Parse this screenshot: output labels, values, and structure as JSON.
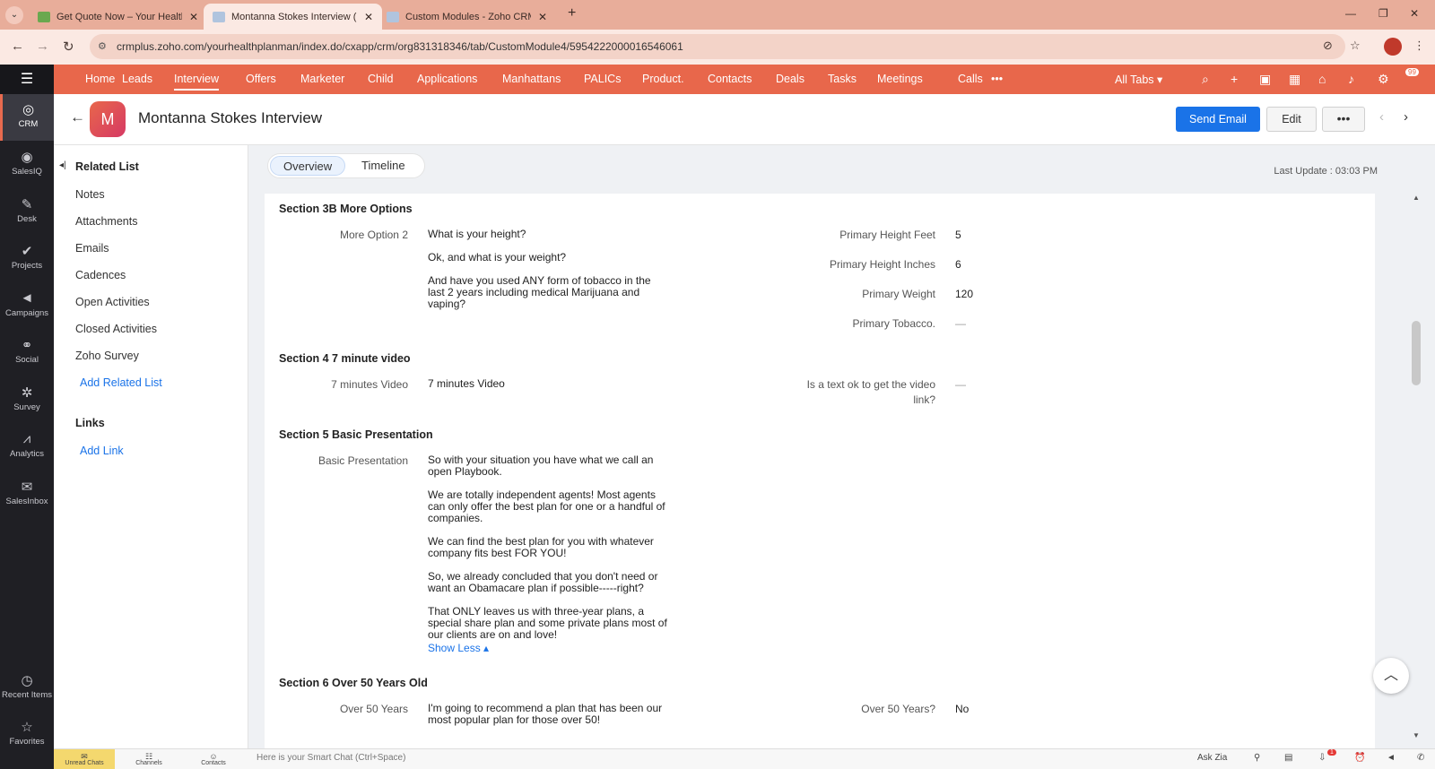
{
  "browser": {
    "tabs": [
      {
        "title": "Get Quote Now – Your Health P",
        "active": false
      },
      {
        "title": "Montanna Stokes Interview (Int",
        "active": true
      },
      {
        "title": "Custom Modules - Zoho CRM",
        "active": false
      }
    ],
    "url": "crmplus.zoho.com/yourhealthplanman/index.do/cxapp/crm/org831318346/tab/CustomModule4/5954222000016546061"
  },
  "rail": {
    "items": [
      {
        "label": "CRM",
        "icon": "crm-icon"
      },
      {
        "label": "SalesIQ",
        "icon": "salesiq-icon"
      },
      {
        "label": "Desk",
        "icon": "desk-icon"
      },
      {
        "label": "Projects",
        "icon": "projects-icon"
      },
      {
        "label": "Campaigns",
        "icon": "campaigns-icon"
      },
      {
        "label": "Social",
        "icon": "social-icon"
      },
      {
        "label": "Survey",
        "icon": "survey-icon"
      },
      {
        "label": "Analytics",
        "icon": "analytics-icon"
      },
      {
        "label": "SalesInbox",
        "icon": "salesinbox-icon"
      }
    ],
    "bottom": [
      {
        "label": "Recent Items",
        "icon": "clock-icon"
      },
      {
        "label": "Favorites",
        "icon": "star-icon"
      }
    ]
  },
  "nav": {
    "items": [
      "Home",
      "Leads",
      "Interview",
      "Offers",
      "Marketer",
      "Child",
      "Applications",
      "Manhattans",
      "PALICs",
      "Product.",
      "Contacts",
      "Deals",
      "Tasks",
      "Meetings",
      "Calls"
    ],
    "active": "Interview",
    "more": "•••",
    "all_tabs": "All Tabs ▾",
    "notification_count": "99"
  },
  "record": {
    "avatar_letter": "M",
    "title": "Montanna Stokes Interview",
    "send_email": "Send Email",
    "edit": "Edit",
    "more": "•••"
  },
  "related": {
    "heading": "Related List",
    "items": [
      "Notes",
      "Attachments",
      "Emails",
      "Cadences",
      "Open Activities",
      "Closed Activities",
      "Zoho Survey"
    ],
    "add_related": "Add Related List",
    "links_heading": "Links",
    "add_link": "Add Link"
  },
  "view": {
    "tabs": [
      "Overview",
      "Timeline"
    ],
    "last_update": "Last Update : 03:03 PM"
  },
  "sections": {
    "s3b": {
      "title": "Section 3B More Options",
      "label": "More Option 2",
      "lines": [
        "What is your height?",
        "Ok, and what is your weight?",
        "And have you used ANY form of tobacco in the",
        "last 2 years including medical Marijuana and",
        "vaping?"
      ],
      "fields": [
        {
          "label": "Primary Height Feet",
          "value": "5"
        },
        {
          "label": "Primary Height Inches",
          "value": "6"
        },
        {
          "label": "Primary Weight",
          "value": "120"
        },
        {
          "label": "Primary Tobacco.",
          "value": "—"
        }
      ]
    },
    "s4": {
      "title": "Section 4 7 minute video",
      "label": "7 minutes Video",
      "value": "7 minutes Video",
      "field_label_1": "Is a text ok to get the video",
      "field_label_2": "link?",
      "field_value": "—"
    },
    "s5": {
      "title": "Section 5 Basic Presentation",
      "label": "Basic Presentation",
      "lines": [
        "So with your situation you have what we call an",
        "open Playbook.",
        "We are totally independent agents! Most agents",
        "can only offer the best plan for one or a handful of",
        "companies.",
        "We can find the best plan for you with whatever",
        "company fits best FOR YOU!",
        "So, we already concluded that you don't need or",
        "want an Obamacare plan if possible-----right?",
        "That ONLY leaves us with three-year plans, a",
        "special share plan and some private plans most of",
        "our clients are on and love!"
      ],
      "show_less": "Show Less ▴"
    },
    "s6": {
      "title": "Section 6 Over 50 Years Old",
      "label": "Over 50 Years",
      "lines": [
        "I'm going to recommend a plan that has been our",
        "most popular plan for those over 50!"
      ],
      "field_label": "Over 50 Years?",
      "field_value": "No"
    }
  },
  "bottombar": {
    "unread": "Unread Chats",
    "channels": "Channels",
    "contacts": "Contacts",
    "smartchat": "Here is your Smart Chat (Ctrl+Space)",
    "ask_zia": "Ask Zia",
    "badge": "1"
  }
}
